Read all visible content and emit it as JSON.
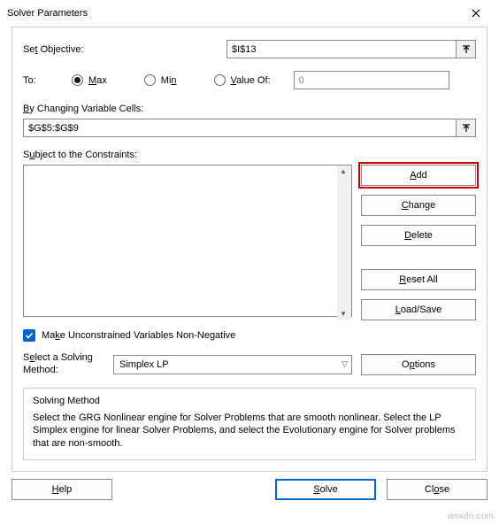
{
  "title": "Solver Parameters",
  "labels": {
    "set_objective": "Set Objective:",
    "to": "To:",
    "by_changing": "By Changing Variable Cells:",
    "subject_to": "Subject to the Constraints:",
    "make_unconstrained": "Make Unconstrained Variables Non-Negative",
    "select_method": "Select a Solving Method:"
  },
  "objective": {
    "value": "$I$13"
  },
  "to_options": {
    "max": "Max",
    "min": "Min",
    "value_of": "Value Of:",
    "value_of_value": "0",
    "selected": "max"
  },
  "changing_cells": {
    "value": "$G$5:$G$9"
  },
  "constraint_buttons": {
    "add": "Add",
    "change": "Change",
    "delete": "Delete",
    "reset_all": "Reset All",
    "load_save": "Load/Save"
  },
  "checkbox": {
    "checked": true
  },
  "method": {
    "selected": "Simplex LP",
    "options_label": "Options"
  },
  "description": {
    "title": "Solving Method",
    "text": "Select the GRG Nonlinear engine for Solver Problems that are smooth nonlinear. Select the LP Simplex engine for linear Solver Problems, and select the Evolutionary engine for Solver problems that are non-smooth."
  },
  "bottom": {
    "help": "Help",
    "solve": "Solve",
    "close": "Close"
  },
  "watermark": "wsxdn.com"
}
